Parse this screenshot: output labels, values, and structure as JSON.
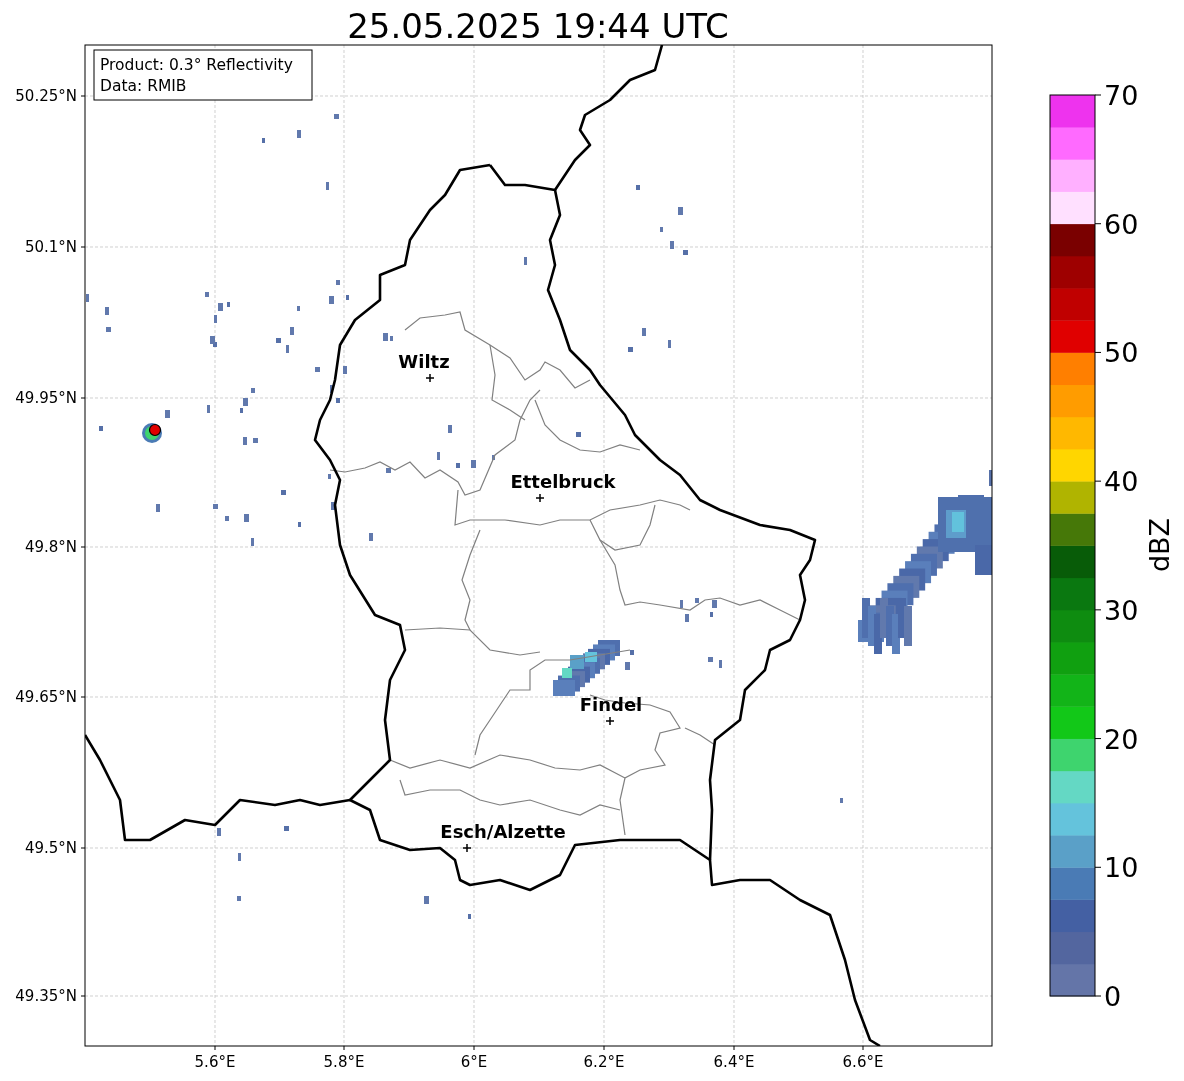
{
  "title": "25.05.2025 19:44 UTC",
  "info_box": {
    "lines": [
      "Product: 0.3° Reflectivity",
      "Data: RMIB"
    ]
  },
  "map": {
    "latitude_labels": [
      "50.25°N",
      "50.1°N",
      "49.95°N",
      "49.8°N",
      "49.65°N",
      "49.5°N",
      "49.35°N"
    ],
    "longitude_labels": [
      "5.6°E",
      "5.8°E",
      "6°E",
      "6.2°E",
      "6.4°E",
      "6.6°E"
    ],
    "places": [
      {
        "name": "Wiltz"
      },
      {
        "name": "Ettelbruck"
      },
      {
        "name": "Findel"
      },
      {
        "name": "Esch/Alzette"
      }
    ]
  },
  "colorbar": {
    "label": "dBZ",
    "ticks": [
      "70",
      "60",
      "50",
      "40",
      "30",
      "20",
      "10",
      "0"
    ],
    "bins": [
      {
        "color": "#6475a8"
      },
      {
        "color": "#53669f"
      },
      {
        "color": "#4460a3"
      },
      {
        "color": "#4a7bb5"
      },
      {
        "color": "#5aa0c8"
      },
      {
        "color": "#64c3dc"
      },
      {
        "color": "#64d8c4"
      },
      {
        "color": "#3ed46e"
      },
      {
        "color": "#12c818"
      },
      {
        "color": "#12b418"
      },
      {
        "color": "#10a010"
      },
      {
        "color": "#0e8c10"
      },
      {
        "color": "#0a7810"
      },
      {
        "color": "#085c08"
      },
      {
        "color": "#467808"
      },
      {
        "color": "#b0b400"
      },
      {
        "color": "#ffd600"
      },
      {
        "color": "#ffb800"
      },
      {
        "color": "#ff9c00"
      },
      {
        "color": "#ff7f00"
      },
      {
        "color": "#e00000"
      },
      {
        "color": "#c00000"
      },
      {
        "color": "#9e0000"
      },
      {
        "color": "#7a0000"
      },
      {
        "color": "#ffe0ff"
      },
      {
        "color": "#ffb0ff"
      },
      {
        "color": "#ff6aff"
      },
      {
        "color": "#ee33ee"
      }
    ]
  }
}
